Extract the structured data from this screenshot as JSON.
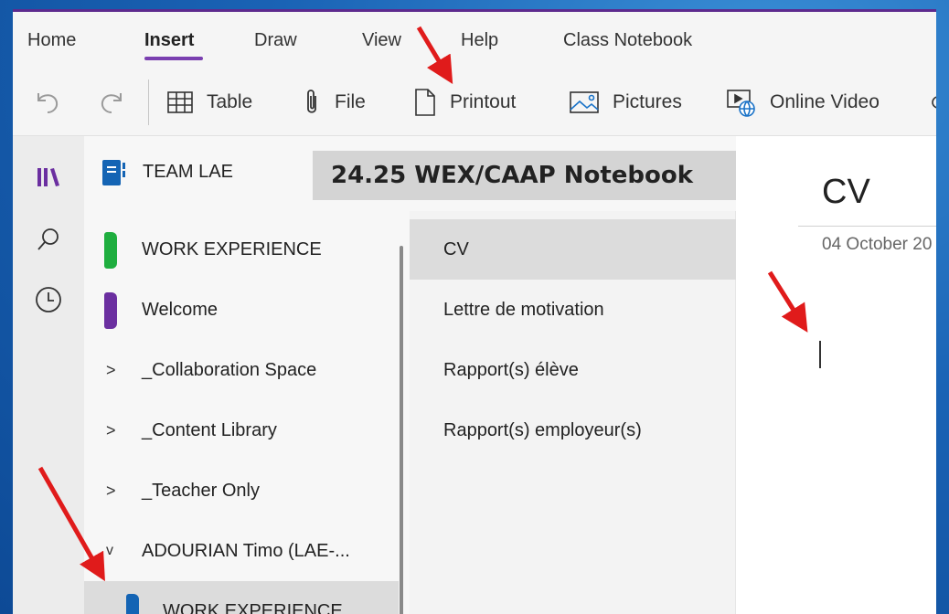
{
  "tabs": [
    "Home",
    "Insert",
    "Draw",
    "View",
    "Help",
    "Class Notebook"
  ],
  "active_tab": "Insert",
  "ribbon": {
    "table": "Table",
    "file": "File",
    "printout": "Printout",
    "pictures": "Pictures",
    "online_video": "Online Video"
  },
  "notebook": {
    "title": "TEAM LAE",
    "label": "24.25 WEX/CAAP Notebook"
  },
  "sections": [
    {
      "label": "WORK EXPERIENCE",
      "color": "#1fae3f"
    },
    {
      "label": "Welcome",
      "color": "#6b2fa0"
    },
    {
      "label": "_Collaboration Space"
    },
    {
      "label": "_Content Library"
    },
    {
      "label": "_Teacher Only"
    },
    {
      "label": "ADOURIAN Timo (LAE-..."
    },
    {
      "label": "WORK EXPERIENCE",
      "color": "#1464b4"
    }
  ],
  "section_chevrons": {
    "collapsed": ">",
    "expanded": "v"
  },
  "pages": [
    "CV",
    "Lettre de motivation",
    "Rapport(s) élève",
    "Rapport(s) employeur(s)"
  ],
  "content": {
    "page_title": "CV",
    "date": "04 October 20"
  },
  "colors": {
    "accent": "#7a3fb0",
    "arrow": "#e01b1b"
  },
  "icons": {
    "undo": "undo-icon",
    "redo": "redo-icon",
    "table": "table-icon",
    "file": "paperclip-icon",
    "printout": "document-icon",
    "pictures": "picture-icon",
    "online_video": "online-video-icon",
    "notebooks": "notebooks-icon",
    "search": "search-icon",
    "recent": "clock-icon",
    "notebook": "notebook-icon"
  }
}
